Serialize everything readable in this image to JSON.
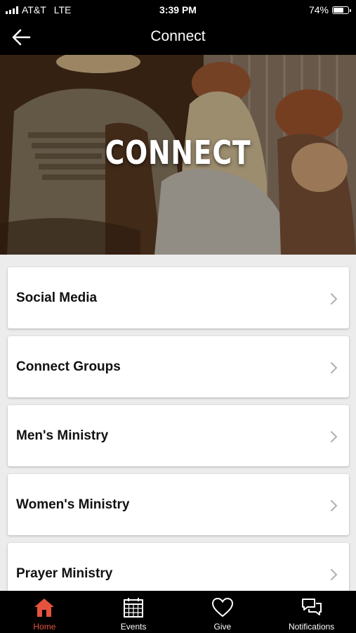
{
  "status_bar": {
    "carrier": "AT&T",
    "network": "LTE",
    "time": "3:39 PM",
    "battery": "74%",
    "battery_level": 0.74
  },
  "nav": {
    "title": "Connect",
    "back_icon": "arrow-left-icon"
  },
  "hero": {
    "title": "CONNECT"
  },
  "menu": {
    "items": [
      {
        "label": "Social Media"
      },
      {
        "label": "Connect Groups"
      },
      {
        "label": "Men's Ministry"
      },
      {
        "label": "Women's Ministry"
      },
      {
        "label": "Prayer Ministry"
      }
    ],
    "chevron_icon": "chevron-right-icon"
  },
  "tabs": [
    {
      "label": "Home",
      "icon": "home-icon",
      "active": true
    },
    {
      "label": "Events",
      "icon": "calendar-icon",
      "active": false
    },
    {
      "label": "Give",
      "icon": "heart-icon",
      "active": false
    },
    {
      "label": "Notifications",
      "icon": "chat-bubbles-icon",
      "active": false
    }
  ],
  "colors": {
    "accent": "#e5533d",
    "bar_background": "#000000",
    "page_background": "#ececec"
  }
}
